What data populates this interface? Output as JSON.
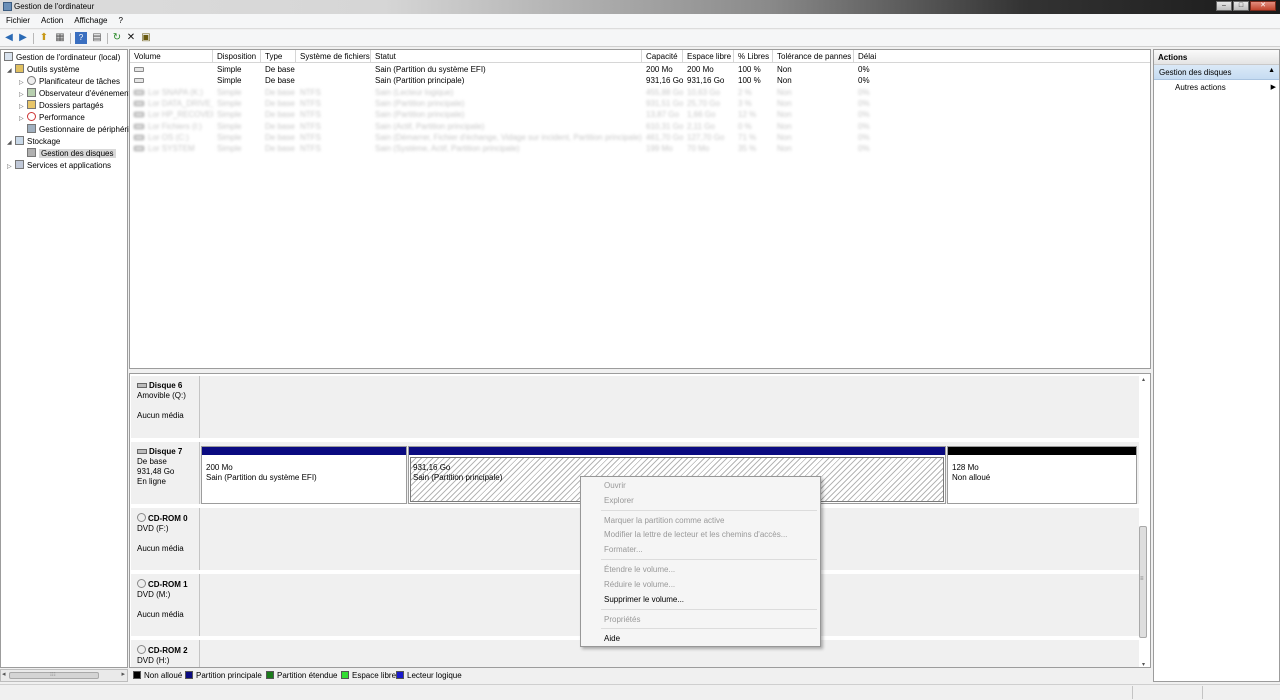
{
  "window": {
    "title": "Gestion de l'ordinateur",
    "buttons": {
      "minimize": "–",
      "maximize": "□",
      "close": "✕"
    }
  },
  "menu": [
    "Fichier",
    "Action",
    "Affichage",
    "?"
  ],
  "toolbar": {
    "back": "◀",
    "forward": "▶",
    "up": "⬆",
    "show_tree": "▦",
    "help": "?",
    "view": "▤",
    "refresh": "↻",
    "delete": "✕",
    "properties": "▣"
  },
  "tree": {
    "root": "Gestion de l'ordinateur (local)",
    "items": [
      {
        "label": "Outils système",
        "arrow": "◢",
        "level": 1
      },
      {
        "label": "Planificateur de tâches",
        "arrow": "▷",
        "level": 2
      },
      {
        "label": "Observateur d'événements",
        "arrow": "▷",
        "level": 2
      },
      {
        "label": "Dossiers partagés",
        "arrow": "▷",
        "level": 2
      },
      {
        "label": "Performance",
        "arrow": "▷",
        "level": 2
      },
      {
        "label": "Gestionnaire de périphériques",
        "arrow": "",
        "level": 2
      },
      {
        "label": "Stockage",
        "arrow": "◢",
        "level": 1
      },
      {
        "label": "Gestion des disques",
        "arrow": "",
        "level": 2
      },
      {
        "label": "Services et applications",
        "arrow": "▷",
        "level": 1
      }
    ],
    "scroll_left": "◂",
    "scroll_right": "▸",
    "scroll_grip": "⁝⁝⁝"
  },
  "volumes": {
    "headers": [
      "Volume",
      "Disposition",
      "Type",
      "Système de fichiers",
      "Statut",
      "Capacité",
      "Espace libre",
      "% Libres",
      "Tolérance de pannes",
      "Délai"
    ],
    "rows": [
      [
        "",
        "Simple",
        "De base",
        "",
        "Sain (Partition du système EFI)",
        "200 Mo",
        "200 Mo",
        "100 %",
        "Non",
        "0%"
      ],
      [
        "",
        "Simple",
        "De base",
        "",
        "Sain (Partition principale)",
        "931,16 Go",
        "931,16 Go",
        "100 %",
        "Non",
        "0%"
      ],
      [
        "Lor SNAPA (K:)",
        "Simple",
        "De base",
        "NTFS",
        "Sain (Lecteur logique)",
        "455,88 Go",
        "10,63 Go",
        "2 %",
        "Non",
        "0%"
      ],
      [
        "Lor DATA_DRIVE_1 (E:)",
        "Simple",
        "De base",
        "NTFS",
        "Sain (Partition principale)",
        "931,51 Go",
        "25,70 Go",
        "3 %",
        "Non",
        "0%"
      ],
      [
        "Lor HP_RECOVERY (D:)",
        "Simple",
        "De base",
        "NTFS",
        "Sain (Partition principale)",
        "13,87 Go",
        "1,66 Go",
        "12 %",
        "Non",
        "0%"
      ],
      [
        "Lor Fichiers (I:)",
        "Simple",
        "De base",
        "NTFS",
        "Sain (Actif, Partition principale)",
        "610,31 Go",
        "2,11 Go",
        "0 %",
        "Non",
        "0%"
      ],
      [
        "Lor OS (C:)",
        "Simple",
        "De base",
        "NTFS",
        "Sain (Démarrer, Fichier d'échange, Vidage sur incident, Partition principale)",
        "461,70 Go",
        "127,70 Go",
        "71 %",
        "Non",
        "0%"
      ],
      [
        "Lor SYSTEM",
        "Simple",
        "De base",
        "NTFS",
        "Sain (Système, Actif, Partition principale)",
        "199 Mo",
        "70 Mo",
        "35 %",
        "Non",
        "0%"
      ]
    ]
  },
  "disks": [
    {
      "name": "Disque 6",
      "type": "Amovible (Q:)",
      "size": "",
      "state": "Aucun média"
    },
    {
      "name": "Disque 7",
      "type": "De base",
      "size": "931,48 Go",
      "state": "En ligne",
      "partitions": [
        {
          "size": "200 Mo",
          "status": "Sain (Partition du système EFI)",
          "color": "#0a0a80"
        },
        {
          "size": "931,16 Go",
          "status": "Sain (Partition principale)",
          "color": "#0a0a80",
          "selected": true
        },
        {
          "size": "128 Mo",
          "status": "Non alloué",
          "color": "#000000"
        }
      ]
    },
    {
      "name": "CD-ROM 0",
      "type": "DVD (F:)",
      "size": "",
      "state": "Aucun média"
    },
    {
      "name": "CD-ROM 1",
      "type": "DVD (M:)",
      "size": "",
      "state": "Aucun média"
    },
    {
      "name": "CD-ROM 2",
      "type": "DVD (H:)",
      "size": "",
      "state": ""
    }
  ],
  "graph_scroll": {
    "up": "▴",
    "down": "▾",
    "grip": "≡"
  },
  "legend": [
    {
      "label": "Non alloué",
      "color": "#000000"
    },
    {
      "label": "Partition principale",
      "color": "#0a0a80"
    },
    {
      "label": "Partition étendue",
      "color": "#1a7a1a"
    },
    {
      "label": "Espace libre",
      "color": "#33dd33"
    },
    {
      "label": "Lecteur logique",
      "color": "#1a1acc"
    }
  ],
  "actions": {
    "header": "Actions",
    "section": "Gestion des disques",
    "section_caret": "▲",
    "more": "Autres actions",
    "more_caret": "▶"
  },
  "context_menu": [
    {
      "label": "Ouvrir",
      "enabled": false
    },
    {
      "label": "Explorer",
      "enabled": false
    },
    {
      "label": "Marquer la partition comme active",
      "enabled": false
    },
    {
      "label": "Modifier la lettre de lecteur et les chemins d'accès...",
      "enabled": false
    },
    {
      "label": "Formater...",
      "enabled": false
    },
    {
      "label": "Étendre le volume...",
      "enabled": false
    },
    {
      "label": "Réduire le volume...",
      "enabled": false
    },
    {
      "label": "Supprimer le volume...",
      "enabled": true
    },
    {
      "label": "Propriétés",
      "enabled": false
    },
    {
      "label": "Aide",
      "enabled": true
    }
  ]
}
